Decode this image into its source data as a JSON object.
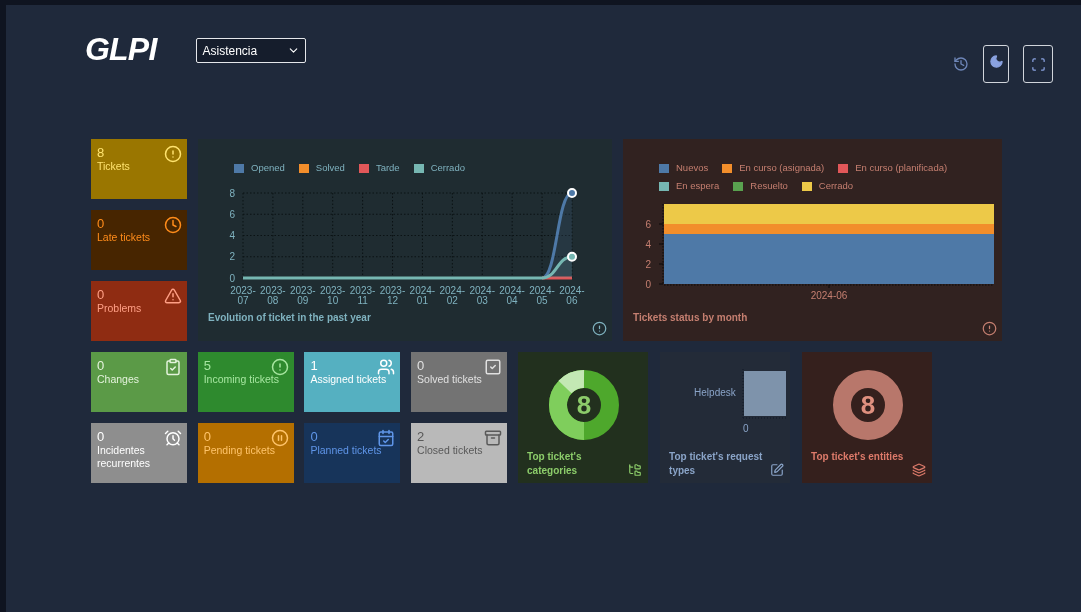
{
  "header": {
    "logo": "GLPI",
    "profile_select": {
      "value": "Asistencia"
    }
  },
  "summary_cards": [
    {
      "count": "8",
      "label": "Tickets",
      "kind": "alert",
      "color": "#9a7600"
    },
    {
      "count": "0",
      "label": "Late tickets",
      "kind": "clock",
      "color": "#472500"
    },
    {
      "count": "0",
      "label": "Problems",
      "kind": "warning",
      "color": "#8f2c12"
    }
  ],
  "evolution_chart": {
    "title": "Evolution of ticket in the past year",
    "chart_data": {
      "type": "line",
      "grid": true,
      "legend": "top",
      "ylim": [
        0,
        8
      ],
      "categories": [
        "2023-07",
        "2023-08",
        "2023-09",
        "2023-10",
        "2023-11",
        "2023-12",
        "2024-01",
        "2024-02",
        "2024-03",
        "2024-04",
        "2024-05",
        "2024-06"
      ],
      "yticks": [
        0,
        2,
        4,
        6,
        8
      ],
      "series": [
        {
          "name": "Opened",
          "color": "#4e79a7",
          "values": [
            null,
            null,
            null,
            null,
            null,
            null,
            null,
            null,
            null,
            null,
            0,
            8
          ]
        },
        {
          "name": "Solved",
          "color": "#f28e2b",
          "values": [
            null,
            null,
            null,
            null,
            null,
            null,
            null,
            null,
            null,
            null,
            null,
            null
          ]
        },
        {
          "name": "Tarde",
          "color": "#e15759",
          "values": [
            null,
            null,
            null,
            null,
            null,
            null,
            null,
            null,
            null,
            null,
            0,
            0
          ]
        },
        {
          "name": "Cerrado",
          "color": "#76b7b2",
          "values": [
            0,
            0,
            0,
            0,
            0,
            0,
            0,
            0,
            0,
            0,
            0,
            2
          ]
        }
      ]
    }
  },
  "status_chart": {
    "title": "Tickets status by month",
    "chart_data": {
      "type": "bar",
      "stacked": true,
      "legend": "top",
      "ylim": [
        0,
        8
      ],
      "categories": [
        "2024-06"
      ],
      "yticks": [
        0,
        2,
        4,
        6
      ],
      "series": [
        {
          "name": "Nuevos",
          "color": "#4e79a7",
          "values": [
            5
          ]
        },
        {
          "name": "En curso (asignada)",
          "color": "#f28e2b",
          "values": [
            1
          ]
        },
        {
          "name": "En curso (planificada)",
          "color": "#e15759",
          "values": [
            0
          ]
        },
        {
          "name": "En espera",
          "color": "#76b7b2",
          "values": [
            0
          ]
        },
        {
          "name": "Resuelto",
          "color": "#59a14f",
          "values": [
            0
          ]
        },
        {
          "name": "Cerrado",
          "color": "#edc948",
          "values": [
            2
          ]
        }
      ]
    }
  },
  "counter_cards": [
    {
      "count": "0",
      "label": "Changes",
      "kind": "clipboard",
      "color": "#5b9a47"
    },
    {
      "count": "5",
      "label": "Incoming tickets",
      "kind": "alert",
      "color": "#2e8a2e"
    },
    {
      "count": "1",
      "label": "Assigned tickets",
      "kind": "users",
      "color": "#55b0c1"
    },
    {
      "count": "0",
      "label": "Solved tickets",
      "kind": "check",
      "color": "#737373"
    },
    {
      "count": "0",
      "label": "Incidentes recurrentes",
      "kind": "alarm",
      "color": "#8e8e8e"
    },
    {
      "count": "0",
      "label": "Pending tickets",
      "kind": "pause",
      "color": "#b46f00"
    },
    {
      "count": "0",
      "label": "Planned tickets",
      "kind": "calendar",
      "color": "#17345a"
    },
    {
      "count": "2",
      "label": "Closed tickets",
      "kind": "archive",
      "color": "#b9b9b9"
    }
  ],
  "top_cards": [
    {
      "kind": "donut",
      "title": "Top ticket's categories",
      "center": "8",
      "color": "#22301e"
    },
    {
      "kind": "hbar",
      "title": "Top ticket's request types",
      "bar_label": "Helpdesk",
      "axis_tick": "0",
      "color": "#232b38"
    },
    {
      "kind": "ring",
      "title": "Top ticket's entities",
      "center": "8",
      "color": "#35201d"
    }
  ]
}
